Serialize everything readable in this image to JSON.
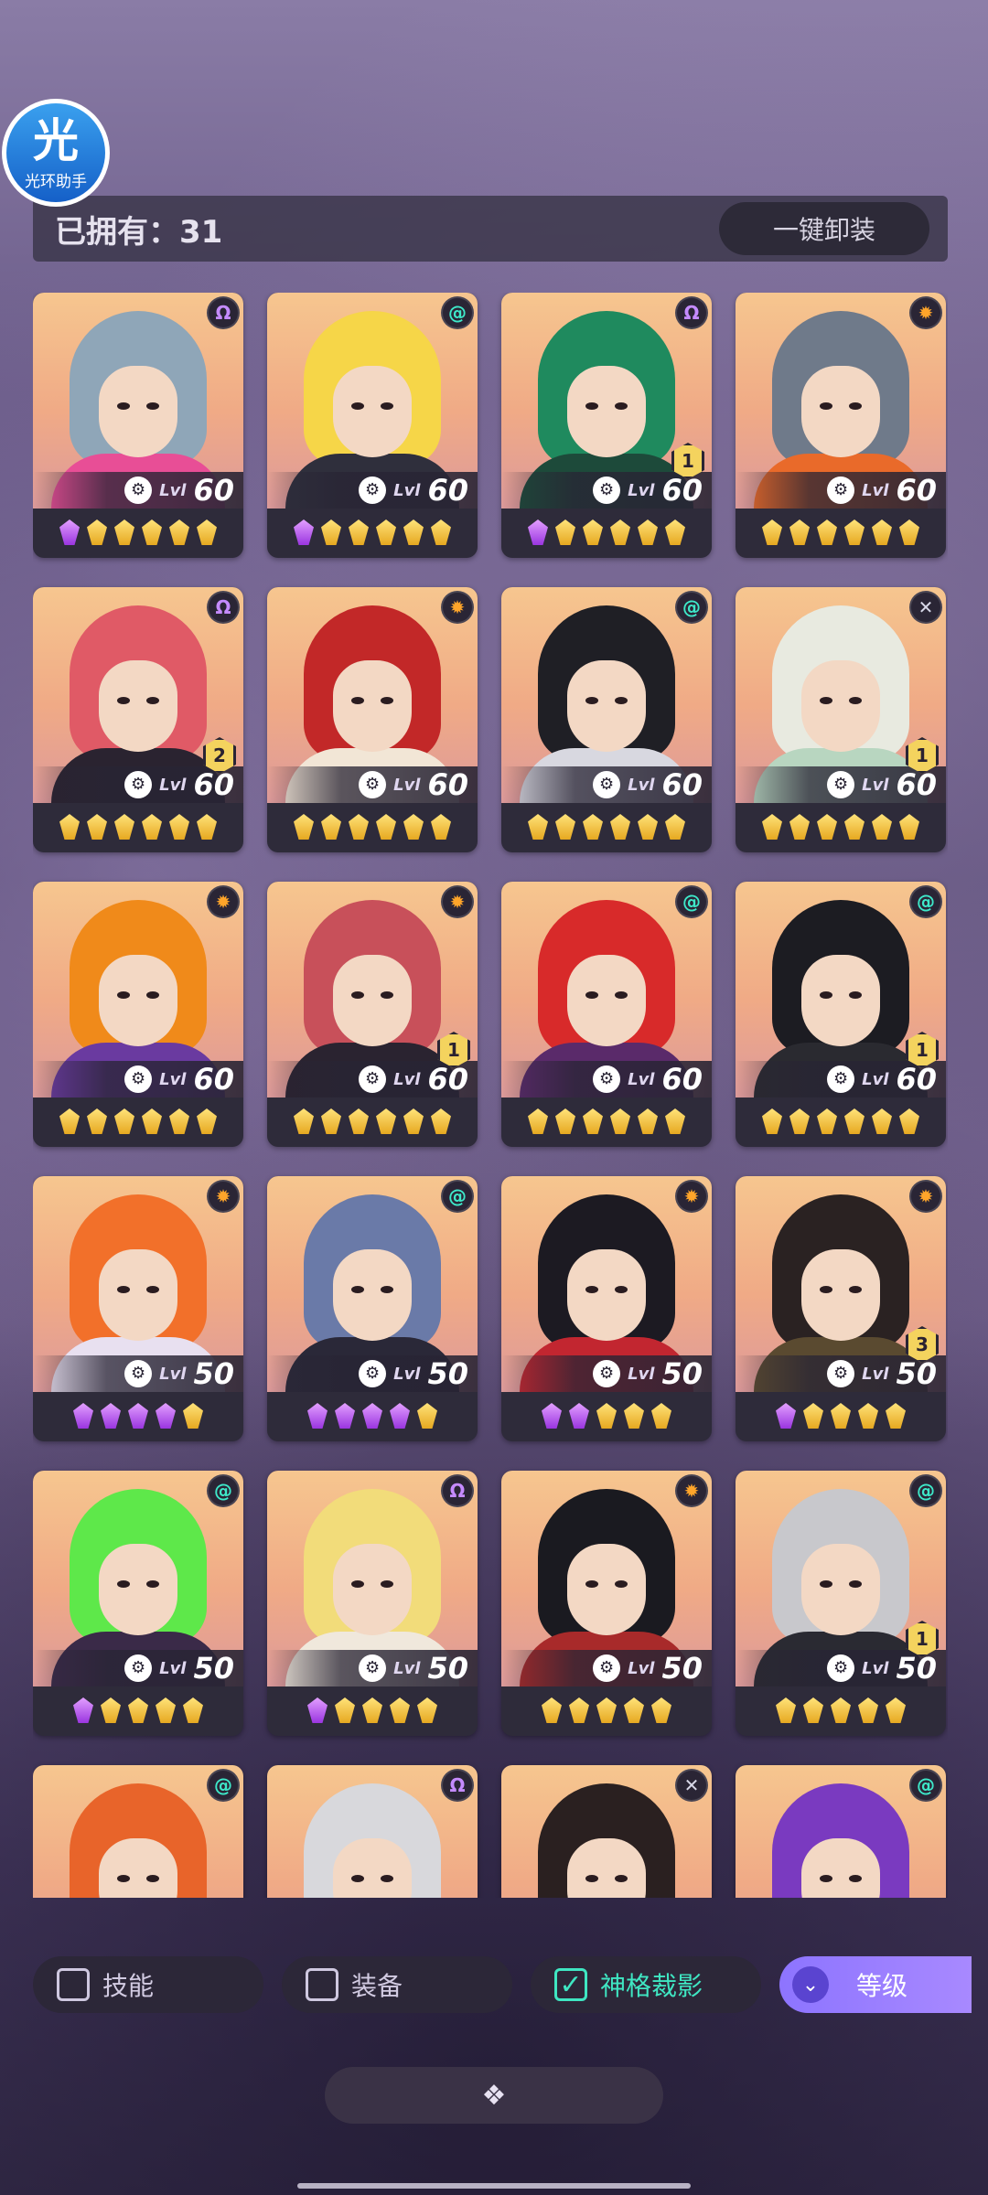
{
  "app": {
    "logo_char": "光",
    "logo_text": "光环助手"
  },
  "header": {
    "owned_label": "已拥有：31",
    "unload_all_button": "一键卸装"
  },
  "colors": {
    "accent_teal": "#3fe6c2",
    "accent_purple": "#9a7cff",
    "panel": "#2e2b3a"
  },
  "heroes": [
    {
      "level_label": "Lvl",
      "level": "60",
      "affinity": "purple",
      "affinity_icon": "omega",
      "rank": "",
      "stars": [
        "purple",
        "gold",
        "gold",
        "gold",
        "gold",
        "gold"
      ],
      "hair": "#8fa6b8",
      "outfit": "#e84e96"
    },
    {
      "level_label": "Lvl",
      "level": "60",
      "affinity": "teal",
      "affinity_icon": "spiral",
      "rank": "",
      "stars": [
        "purple",
        "gold",
        "gold",
        "gold",
        "gold",
        "gold"
      ],
      "hair": "#f6d648",
      "outfit": "#2f2f3c"
    },
    {
      "level_label": "Lvl",
      "level": "60",
      "affinity": "purple",
      "affinity_icon": "omega",
      "rank": "1",
      "stars": [
        "purple",
        "gold",
        "gold",
        "gold",
        "gold",
        "gold"
      ],
      "hair": "#1f8a5e",
      "outfit": "#1d4a3a"
    },
    {
      "level_label": "Lvl",
      "level": "60",
      "affinity": "orange",
      "affinity_icon": "sun",
      "rank": "",
      "stars": [
        "gold",
        "gold",
        "gold",
        "gold",
        "gold",
        "gold"
      ],
      "hair": "#6f7a8a",
      "outfit": "#e96a2a"
    },
    {
      "level_label": "Lvl",
      "level": "60",
      "affinity": "purple",
      "affinity_icon": "omega",
      "rank": "2",
      "stars": [
        "gold",
        "gold",
        "gold",
        "gold",
        "gold",
        "gold"
      ],
      "hair": "#e05a66",
      "outfit": "#2a2330"
    },
    {
      "level_label": "Lvl",
      "level": "60",
      "affinity": "orange",
      "affinity_icon": "sun",
      "rank": "",
      "stars": [
        "gold",
        "gold",
        "gold",
        "gold",
        "gold",
        "gold"
      ],
      "hair": "#c22828",
      "outfit": "#f2e6d6"
    },
    {
      "level_label": "Lvl",
      "level": "60",
      "affinity": "teal",
      "affinity_icon": "spiral",
      "rank": "",
      "stars": [
        "gold",
        "gold",
        "gold",
        "gold",
        "gold",
        "gold"
      ],
      "hair": "#1f1f25",
      "outfit": "#d8d8e0"
    },
    {
      "level_label": "Lvl",
      "level": "60",
      "affinity": "silver",
      "affinity_icon": "cross",
      "rank": "1",
      "stars": [
        "gold",
        "gold",
        "gold",
        "gold",
        "gold",
        "gold"
      ],
      "hair": "#e8eae0",
      "outfit": "#b8d6c0"
    },
    {
      "level_label": "Lvl",
      "level": "60",
      "affinity": "orange",
      "affinity_icon": "sun",
      "rank": "",
      "stars": [
        "gold",
        "gold",
        "gold",
        "gold",
        "gold",
        "gold"
      ],
      "hair": "#f08a1a",
      "outfit": "#6a3aa0"
    },
    {
      "level_label": "Lvl",
      "level": "60",
      "affinity": "orange",
      "affinity_icon": "sun",
      "rank": "1",
      "stars": [
        "gold",
        "gold",
        "gold",
        "gold",
        "gold",
        "gold"
      ],
      "hair": "#c8505a",
      "outfit": "#2a2330"
    },
    {
      "level_label": "Lvl",
      "level": "60",
      "affinity": "teal",
      "affinity_icon": "spiral",
      "rank": "",
      "stars": [
        "gold",
        "gold",
        "gold",
        "gold",
        "gold",
        "gold"
      ],
      "hair": "#d82a2a",
      "outfit": "#5a2a6a"
    },
    {
      "level_label": "Lvl",
      "level": "60",
      "affinity": "teal",
      "affinity_icon": "spiral",
      "rank": "1",
      "stars": [
        "gold",
        "gold",
        "gold",
        "gold",
        "gold",
        "gold"
      ],
      "hair": "#1c1c22",
      "outfit": "#2a2a30"
    },
    {
      "level_label": "Lvl",
      "level": "50",
      "affinity": "orange",
      "affinity_icon": "sun",
      "rank": "",
      "stars": [
        "purple",
        "purple",
        "purple",
        "purple",
        "gold"
      ],
      "hair": "#f2702a",
      "outfit": "#e8e0f0"
    },
    {
      "level_label": "Lvl",
      "level": "50",
      "affinity": "teal",
      "affinity_icon": "spiral",
      "rank": "",
      "stars": [
        "purple",
        "purple",
        "purple",
        "purple",
        "gold"
      ],
      "hair": "#6a7aa8",
      "outfit": "#2a2838"
    },
    {
      "level_label": "Lvl",
      "level": "50",
      "affinity": "orange",
      "affinity_icon": "sun",
      "rank": "",
      "stars": [
        "purple",
        "purple",
        "gold",
        "gold",
        "gold"
      ],
      "hair": "#1c1a22",
      "outfit": "#c22630"
    },
    {
      "level_label": "Lvl",
      "level": "50",
      "affinity": "orange",
      "affinity_icon": "sun",
      "rank": "3",
      "stars": [
        "purple",
        "gold",
        "gold",
        "gold",
        "gold"
      ],
      "hair": "#2a2222",
      "outfit": "#5a4a30"
    },
    {
      "level_label": "Lvl",
      "level": "50",
      "affinity": "teal",
      "affinity_icon": "spiral",
      "rank": "",
      "stars": [
        "purple",
        "gold",
        "gold",
        "gold",
        "gold"
      ],
      "hair": "#5ee84a",
      "outfit": "#3a2a48"
    },
    {
      "level_label": "Lvl",
      "level": "50",
      "affinity": "purple",
      "affinity_icon": "omega",
      "rank": "",
      "stars": [
        "purple",
        "gold",
        "gold",
        "gold",
        "gold"
      ],
      "hair": "#f2dc7a",
      "outfit": "#f0e8dc"
    },
    {
      "level_label": "Lvl",
      "level": "50",
      "affinity": "orange",
      "affinity_icon": "sun",
      "rank": "",
      "stars": [
        "gold",
        "gold",
        "gold",
        "gold",
        "gold"
      ],
      "hair": "#1a1a20",
      "outfit": "#a82a2a"
    },
    {
      "level_label": "Lvl",
      "level": "50",
      "affinity": "teal",
      "affinity_icon": "spiral",
      "rank": "1",
      "stars": [
        "gold",
        "gold",
        "gold",
        "gold",
        "gold"
      ],
      "hair": "#c8c8cc",
      "outfit": "#2a2a32"
    },
    {
      "level_label": "",
      "level": "",
      "affinity": "teal",
      "affinity_icon": "spiral",
      "rank": "",
      "stars": [],
      "hair": "#e8642a",
      "outfit": "#1a6a8a"
    },
    {
      "level_label": "",
      "level": "",
      "affinity": "purple",
      "affinity_icon": "omega",
      "rank": "",
      "stars": [],
      "hair": "#d8d8dc",
      "outfit": "#f0f0f0"
    },
    {
      "level_label": "",
      "level": "",
      "affinity": "silver",
      "affinity_icon": "cross",
      "rank": "",
      "stars": [],
      "hair": "#2a2020",
      "outfit": "#8a5a3a"
    },
    {
      "level_label": "",
      "level": "",
      "affinity": "teal",
      "affinity_icon": "spiral",
      "rank": "",
      "stars": [],
      "hair": "#7a3ac0",
      "outfit": "#5a3a28"
    }
  ],
  "filters": {
    "skill": {
      "label": "技能",
      "checked": false
    },
    "equipment": {
      "label": "装备",
      "checked": false
    },
    "divinity": {
      "label": "神格裁影",
      "checked": true
    },
    "sort_button": "等级"
  },
  "bottom": {
    "toggle_icon": "expand-diamonds-icon"
  }
}
